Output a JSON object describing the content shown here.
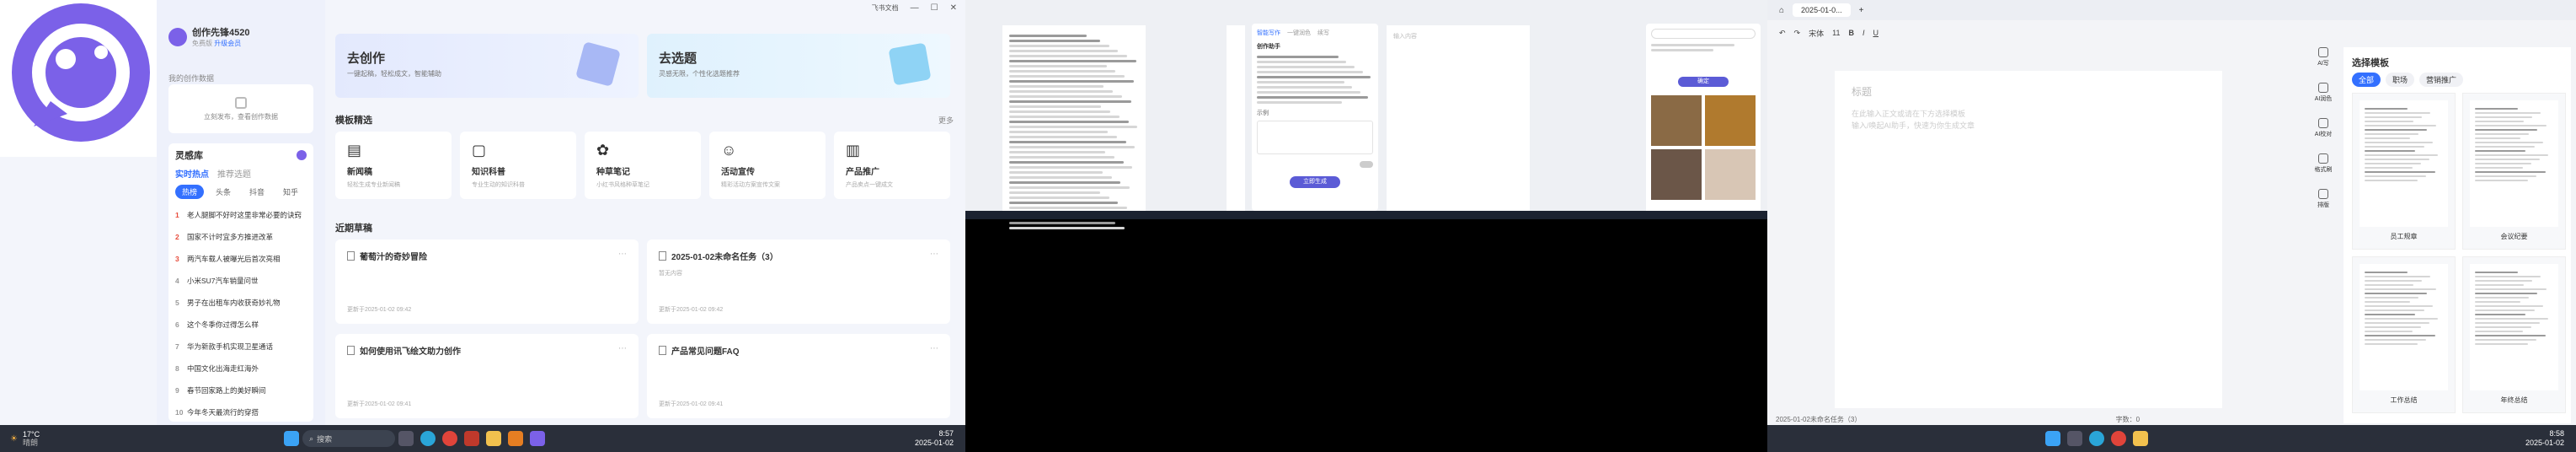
{
  "app": {
    "window_title": "飞书文档",
    "user_name": "创作先锋4520",
    "user_sub": "免费版",
    "user_link": "升级会员"
  },
  "sidebar": {
    "section_title": "我的创作数据",
    "empty_text": "立刻发布，查看创作数据",
    "tool_title": "灵感库",
    "tabs": [
      "实时热点",
      "推荐选题"
    ],
    "filters": [
      "热榜",
      "头条",
      "抖音",
      "知乎"
    ],
    "hot": [
      "老人腿脚不好时这里非常必要的诀窍",
      "国家不计时宜多方推进改革",
      "两汽车载人被曝光后首次亮相",
      "小米SU7汽车销量问世",
      "男子在出租车内收获奇妙礼物",
      "这个冬季你过得怎么样",
      "华为新款手机实现卫星通话",
      "中国文化出海走红海外",
      "春节回家路上的美好瞬间",
      "今年冬天最流行的穿搭"
    ]
  },
  "main": {
    "create_title": "去创作",
    "create_sub": "一键起稿，轻松成文，智能辅助",
    "topic_title": "去选题",
    "topic_sub": "灵感无限，个性化选题推荐",
    "templates_title": "模板精选",
    "more": "更多",
    "templates": [
      {
        "title": "新闻稿",
        "sub": "轻松生成专业新闻稿"
      },
      {
        "title": "知识科普",
        "sub": "专业生动的知识科普"
      },
      {
        "title": "种草笔记",
        "sub": "小红书风格种草笔记"
      },
      {
        "title": "活动宣传",
        "sub": "精彩活动方案宣传文案"
      },
      {
        "title": "产品推广",
        "sub": "产品卖点一键成文"
      }
    ],
    "recent_title": "近期草稿",
    "docs": [
      {
        "title": "葡萄汁的奇妙冒险",
        "date": "更新于2025-01-02 09:42"
      },
      {
        "title": "2025-01-02未命名任务（3）",
        "sub": "暂无内容",
        "date": "更新于2025-01-02 09:42"
      },
      {
        "title": "如何使用讯飞绘文助力创作",
        "date": "更新于2025-01-02 09:41"
      },
      {
        "title": "产品常见问题FAQ",
        "date": "更新于2025-01-02 09:41"
      }
    ]
  },
  "taskbar1": {
    "weather": "17°C",
    "weather_sub": "晴朗",
    "search": "搜索",
    "time": "8:57",
    "date": "2025-01-02"
  },
  "screen2": {
    "panel_title": "创作助手",
    "tabs": [
      "智能写作",
      "一键润色",
      "续写"
    ],
    "search_ph": "输入内容",
    "note_label": "示例",
    "btn": "立即生成",
    "btn2": "确定"
  },
  "screen3": {
    "tab": "2025-01-0...",
    "toolbar_fonts": [
      "宋体",
      "11"
    ],
    "doc_title_ph": "标题",
    "doc_hint": "在此输入正文或请在下方选择模板",
    "doc_hint2": "输入/唤起AI助手，快速为你生成文章",
    "right_title": "选择模板",
    "right_tabs": [
      "全部",
      "职场",
      "营销推广"
    ],
    "side_btns": [
      "AI写",
      "AI润色",
      "AI校对",
      "格式刷",
      "排版"
    ],
    "tpl_names": [
      "员工规章",
      "会议纪要",
      "工作总结",
      "年终总结"
    ],
    "status": "2025-01-02未命名任务（3）",
    "words": "字数：0",
    "time": "8:58",
    "date": "2025-01-02"
  },
  "colors": {
    "accent": "#3370ff",
    "brand": "#5b5bd6"
  }
}
